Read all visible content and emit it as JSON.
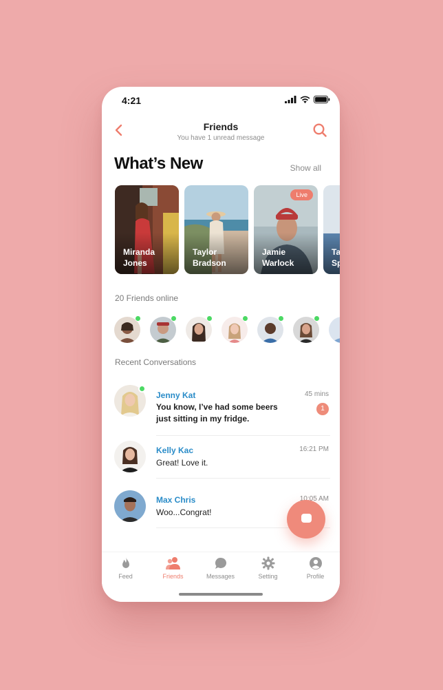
{
  "status_bar": {
    "time": "4:21"
  },
  "header": {
    "title": "Friends",
    "subtitle": "You have 1 unread message",
    "back_icon": "chevron-left-icon",
    "search_icon": "search-icon"
  },
  "whats_new": {
    "title": "What’s New",
    "show_all": "Show all",
    "stories": [
      {
        "name": "Miranda\nJones",
        "live": ""
      },
      {
        "name": "Taylor\nBradson",
        "live": ""
      },
      {
        "name": "Jamie\nWarlock",
        "live": "Live"
      },
      {
        "name": "Ta\nSp",
        "live": ""
      }
    ]
  },
  "friends_online": {
    "label": "20 Friends online"
  },
  "recent": {
    "label": "Recent Conversations",
    "conversations": [
      {
        "name": "Jenny Kat",
        "time": "45 mins",
        "message": "You know, I’ve had some beers just sitting in my fridge.",
        "unread": "1",
        "online": true
      },
      {
        "name": "Kelly Kac",
        "time": "16:21 PM",
        "message": "Great! Love it.",
        "unread": "",
        "online": false
      },
      {
        "name": "Max Chris",
        "time": "10:05 AM",
        "message": "Woo...Congrat!",
        "unread": "",
        "online": false
      }
    ]
  },
  "tabs": [
    {
      "label": "Feed",
      "icon": "flame-icon"
    },
    {
      "label": "Friends",
      "icon": "friends-icon",
      "active": true
    },
    {
      "label": "Messages",
      "icon": "chat-bubble-icon"
    },
    {
      "label": "Setting",
      "icon": "gear-icon"
    },
    {
      "label": "Profile",
      "icon": "user-icon"
    }
  ],
  "colors": {
    "background": "#eeaaaa",
    "accent": "#ee7d6d",
    "name_blue": "#2a8cc8",
    "online_green": "#4cd964"
  }
}
